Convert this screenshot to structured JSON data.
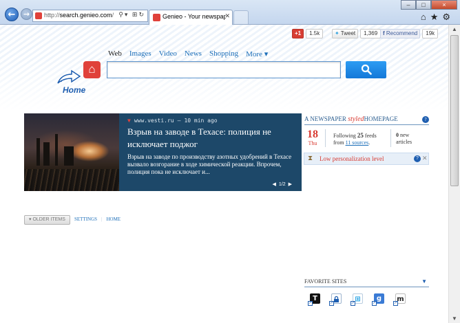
{
  "browser": {
    "address_url": "http://search.genieo.com/",
    "address_url_prefix": "http://",
    "address_url_host": "search.genieo.com",
    "address_url_suffix": "/",
    "tab_title": "Genieo - Your newspaper st...",
    "window_controls": {
      "minimize": "–",
      "maximize": "□",
      "close": "×"
    },
    "toolbar_icons": [
      "home-icon",
      "favorites-star-icon",
      "settings-gear-icon"
    ]
  },
  "social": {
    "gplus_label": "+1",
    "gplus_count": "1.5k",
    "tweet_label": "Tweet",
    "tweet_count": "1,369",
    "facebook_label": "Recommend",
    "facebook_count": "19k"
  },
  "search": {
    "tabs": [
      {
        "label": "Web",
        "active": true
      },
      {
        "label": "Images",
        "active": false
      },
      {
        "label": "Video",
        "active": false
      },
      {
        "label": "News",
        "active": false
      },
      {
        "label": "Shopping",
        "active": false
      },
      {
        "label": "More ▾",
        "active": false
      }
    ],
    "query": "",
    "home_label": "Home"
  },
  "news": {
    "source": "www.vesti.ru",
    "time": "10 min ago",
    "title": "Взрыв на заводе в Техасе: полиция не исключает поджог",
    "body": "Взрыв на заводе по производству азотных удобрений в Техасе вызвало возгорание в ходе химической реакции. Впрочем, полиция пока не исключает и...",
    "pager": "1/2"
  },
  "right_panel": {
    "title_part1": "A NEWSPAPER ",
    "title_styled": "styled",
    "title_part2": "HOMEPAGE",
    "date_day": "18",
    "date_dow": "Thu",
    "following_prefix": "Following ",
    "following_count": "25",
    "following_mid": " feeds",
    "following_from": "from ",
    "following_sources": "11 sources",
    "following_suffix": ".",
    "new_count": "0",
    "new_label_1": " new",
    "new_label_2": "articles",
    "personalization": "Low personalization level"
  },
  "bottom": {
    "older_items": "▾ OLDER ITEMS",
    "settings": "SETTINGS",
    "home": "HOME"
  },
  "favorite_sites": {
    "title": "FAVORITE SITES",
    "sites": [
      {
        "glyph": "T",
        "icon": "tumblr-icon"
      },
      {
        "glyph": "🔒",
        "icon": "lock-site-icon"
      },
      {
        "glyph": "⊞",
        "icon": "windows-icon"
      },
      {
        "glyph": "g",
        "icon": "google-icon"
      },
      {
        "glyph": "m",
        "icon": "m-site-icon"
      }
    ]
  },
  "colors": {
    "accent_blue": "#1e5eb0",
    "genieo_red": "#e0413a",
    "news_bg": "#1d4869"
  }
}
